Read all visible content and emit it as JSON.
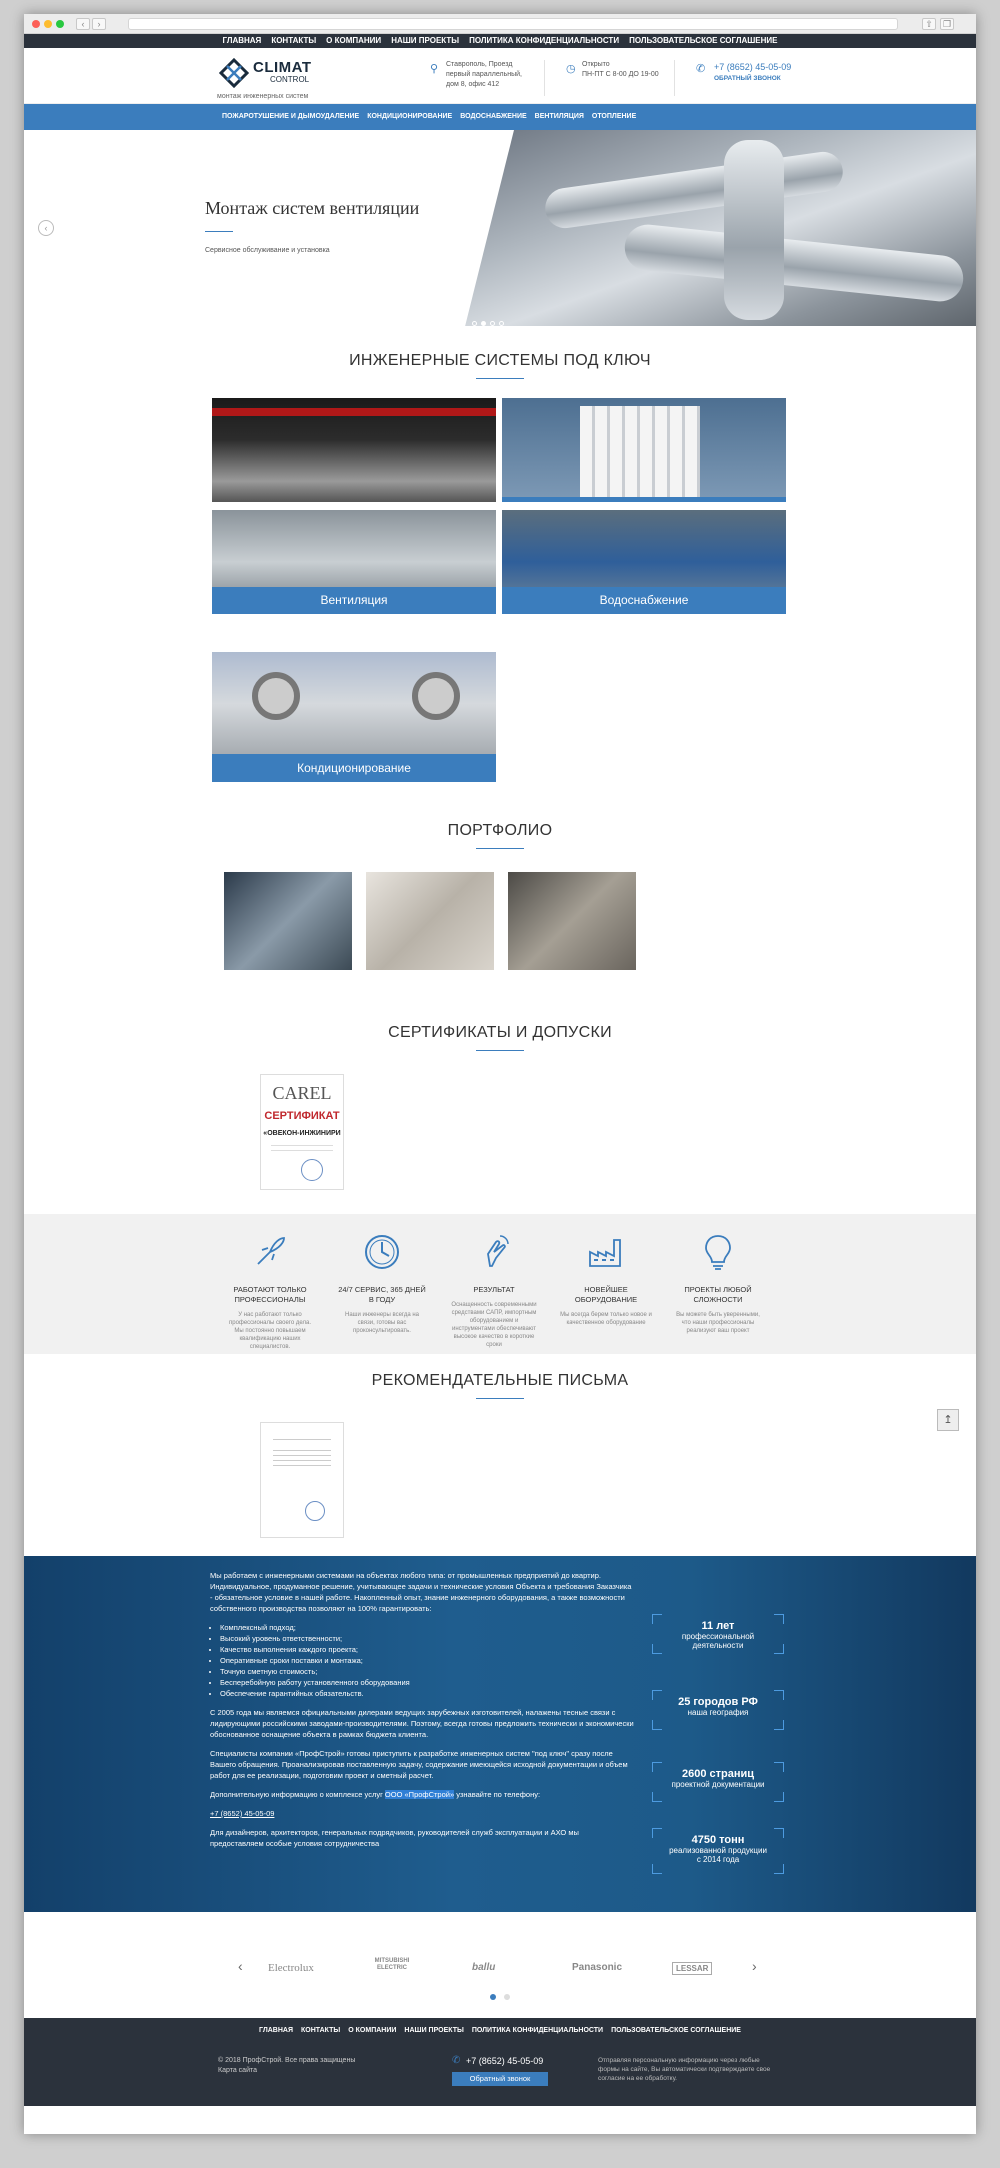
{
  "topnav": [
    "ГЛАВНАЯ",
    "КОНТАКТЫ",
    "О КОМПАНИИ",
    "НАШИ ПРОЕКТЫ",
    "ПОЛИТИКА КОНФИДЕНЦИАЛЬНОСТИ",
    "ПОЛЬЗОВАТЕЛЬСКОЕ СОГЛАШЕНИЕ"
  ],
  "logo": {
    "t1": "CLIMAT",
    "t2": "CONTROL",
    "sub": "монтаж инженерных систем"
  },
  "header": {
    "addr1": "Ставрополь, Проезд",
    "addr2": "первый параллельный,",
    "addr3": "дом 8, офис 412",
    "hours1": "Открыто",
    "hours2": "ПН-ПТ С 8-00 ДО 19-00",
    "phone": "+7 (8652) 45-05-09",
    "callback": "ОБРАТНЫЙ ЗВОНОК"
  },
  "mainnav": [
    "ПОЖАРОТУШЕНИЕ И ДЫМОУДАЛЕНИЕ",
    "КОНДИЦИОНИРОВАНИЕ",
    "ВОДОСНАБЖЕНИЕ",
    "ВЕНТИЛЯЦИЯ",
    "ОТОПЛЕНИЕ"
  ],
  "hero": {
    "title": "Монтаж систем вентиляции",
    "sub": "Сервисное обслуживание и установка"
  },
  "systems": {
    "title": "ИНЖЕНЕРНЫЕ СИСТЕМЫ ПОД КЛЮЧ",
    "tiles": [
      "Вентиляция",
      "Водоснабжение",
      "Кондиционирование"
    ]
  },
  "portfolio": {
    "title": "ПОРТФОЛИО"
  },
  "certs": {
    "title": "СЕРТИФИКАТЫ И ДОПУСКИ",
    "brand": "CAREL",
    "label": "СЕРТИФИКАТ",
    "company": "«ОВЕКОН-ИНЖИНИРИ"
  },
  "features": [
    {
      "t": "РАБОТАЮТ ТОЛЬКО ПРОФЕССИОНАЛЫ",
      "d": "У нас работают только профессионалы своего дела. Мы постоянно повышаем квалификацию наших специалистов.",
      "icon": "rocket-icon"
    },
    {
      "t": "24/7 СЕРВИС, 365 ДНЕЙ В ГОДУ",
      "d": "Наши инженеры всегда на связи, готовы вас проконсультировать.",
      "icon": "clock-icon"
    },
    {
      "t": "РЕЗУЛЬТАТ",
      "d": "Оснащенность современными средствами САПР, импортным оборудованием и инструментами обеспечивают высокое качество в короткие сроки",
      "icon": "pointer-icon"
    },
    {
      "t": "НОВЕЙШЕЕ ОБОРУДОВАНИЕ",
      "d": "Мы всегда берем только новое и качественное оборудование",
      "icon": "factory-icon"
    },
    {
      "t": "ПРОЕКТЫ ЛЮБОЙ СЛОЖНОСТИ",
      "d": "Вы можете быть уверенными, что наши профессионалы реализуют ваш проект",
      "icon": "bulb-icon"
    }
  ],
  "letters": {
    "title": "РЕКОМЕНДАТЕЛЬНЫЕ ПИСЬМА"
  },
  "about": {
    "p1": "Мы работаем с инженерными системами на объектах любого типа: от промышленных предприятий до квартир. Индивидуальное, продуманное решение, учитывающее задачи и технические условия Объекта и требования Заказчика - обязательное условие в нашей работе. Накопленный опыт, знание инженерного оборудования, а также возможности собственного производства позволяют на 100% гарантировать:",
    "list": [
      "Комплексный подход;",
      "Высокий уровень ответственности;",
      "Качество выполнения каждого проекта;",
      "Оперативные сроки поставки и монтажа;",
      "Точную сметную стоимость;",
      "Бесперебойную работу установленного оборудования",
      "Обеспечение гарантийных обязательств."
    ],
    "p2": "С 2005 года мы являемся официальными дилерами ведущих зарубежных изготовителей, налажены тесные связи с лидирующими российскими заводами-производителями. Поэтому, всегда готовы предложить технически и экономически обоснованное оснащение объекта в рамках бюджета клиента.",
    "p3": "Специалисты компании «ПрофСтрой» готовы приступить к разработке инженерных систем \"под ключ\" сразу после Вашего обращения. Проанализировав поставленную задачу, содержание имеющейся исходной документации и объем работ для ее реализации, подготовим проект и сметный расчет.",
    "p4a": "Дополнительную информацию о комплексе услуг ",
    "p4h": "ООО «ПрофСтрой»",
    "p4b": " узнавайте по телефону:",
    "phone": "+7 (8652) 45-05-09",
    "p5": "Для дизайнеров, архитекторов, генеральных подрядчиков, руководителей служб эксплуатации и АХО мы предоставляем особые условия сотрудничества"
  },
  "stats": [
    {
      "n": "11 лет",
      "l1": "профессиональной",
      "l2": "деятельности"
    },
    {
      "n": "25 городов РФ",
      "l1": "наша география",
      "l2": ""
    },
    {
      "n": "2600 страниц",
      "l1": "проектной документации",
      "l2": ""
    },
    {
      "n": "4750 тонн",
      "l1": "реализованной продукции",
      "l2": "с 2014 года"
    }
  ],
  "brands": [
    "Electrolux",
    "MITSUBISHI ELECTRIC",
    "ballu",
    "Panasonic",
    "LESSAR"
  ],
  "footer": {
    "nav": [
      "ГЛАВНАЯ",
      "КОНТАКТЫ",
      "О КОМПАНИИ",
      "НАШИ ПРОЕКТЫ",
      "ПОЛИТИКА КОНФИДЕНЦИАЛЬНОСТИ",
      "ПОЛЬЗОВАТЕЛЬСКОЕ СОГЛАШЕНИЕ"
    ],
    "copy": "© 2018 ПрофСтрой. Все права защищены",
    "map": "Карта сайта",
    "phone": "+7 (8652) 45-05-09",
    "btn": "Обратный звонок",
    "note": "Отправляя персональную информацию через любые формы на сайте, Вы автоматически подтверждаете свое согласие на ее обработку."
  }
}
